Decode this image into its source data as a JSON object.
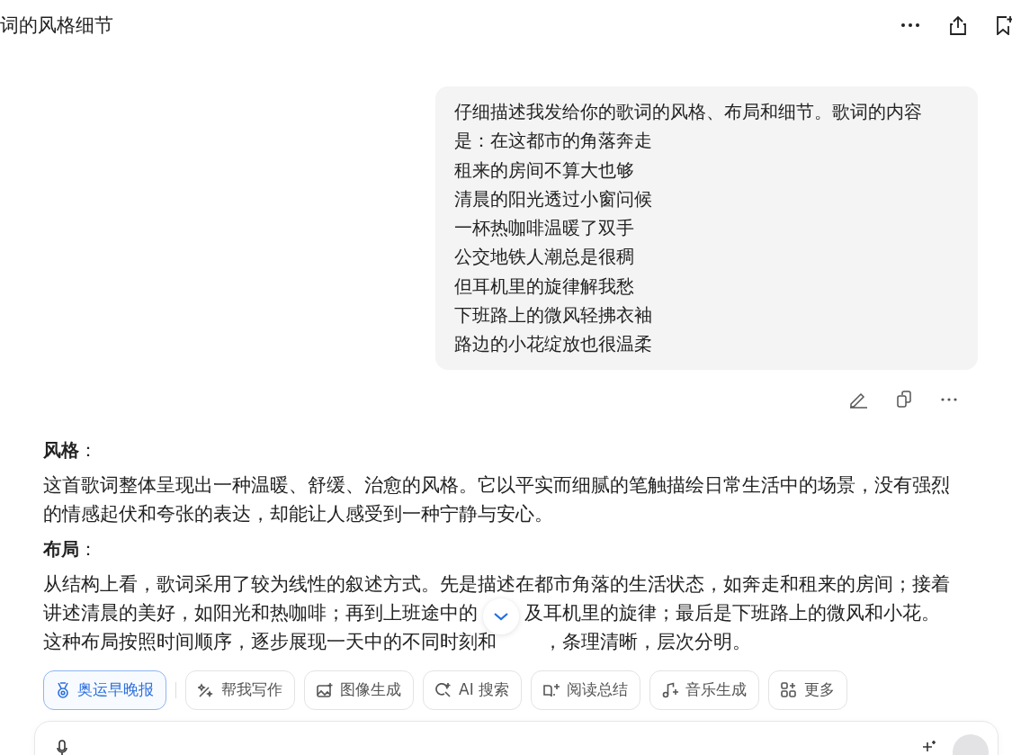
{
  "header": {
    "title": "词的风格细节"
  },
  "user_message": {
    "lines": [
      "仔细描述我发给你的歌词的风格、布局和细节。歌词的内容",
      "是：在这都市的角落奔走",
      "租来的房间不算大也够",
      "清晨的阳光透过小窗问候",
      "一杯热咖啡温暖了双手",
      "公交地铁人潮总是很稠",
      "但耳机里的旋律解我愁",
      "下班路上的微风轻拂衣袖",
      "路边的小花绽放也很温柔"
    ]
  },
  "sections": [
    {
      "heading": "**风格**：",
      "lines": [
        [
          "这首歌词整体呈现出一种温暖、舒缓、治愈的风格。它以平实而细腻的笔触描绘日常生活中的场景，没有强烈"
        ],
        [
          "的情感起伏和夸张的表达，却能让人感受到一种宁静与安心。"
        ]
      ]
    },
    {
      "heading": "**布局**：",
      "lines": [
        [
          "从结构上看，歌词采用了较为线性的叙述方式。先是描述在都市角落的生活状态，如奔走和租来的房间；接着"
        ],
        [
          "讲述清晨的美好，如阳光和热咖啡；再到上班途中的",
          "及耳机里的旋律；最后是下班路上的微风和小花。"
        ],
        [
          "这种布局按照时间顺序，逐步展现一天中的不同时刻和",
          "，条理清晰，层次分明。"
        ]
      ]
    }
  ],
  "chips": [
    {
      "kind": "medal",
      "label": "奥运早晚报",
      "selected": true
    },
    {
      "kind": "write",
      "label": "帮我写作",
      "selected": false
    },
    {
      "kind": "image",
      "label": "图像生成",
      "selected": false
    },
    {
      "kind": "search",
      "label": "AI 搜索",
      "selected": false
    },
    {
      "kind": "read",
      "label": "阅读总结",
      "selected": false
    },
    {
      "kind": "music",
      "label": "音乐生成",
      "selected": false
    },
    {
      "kind": "more",
      "label": "更多",
      "selected": false
    }
  ]
}
